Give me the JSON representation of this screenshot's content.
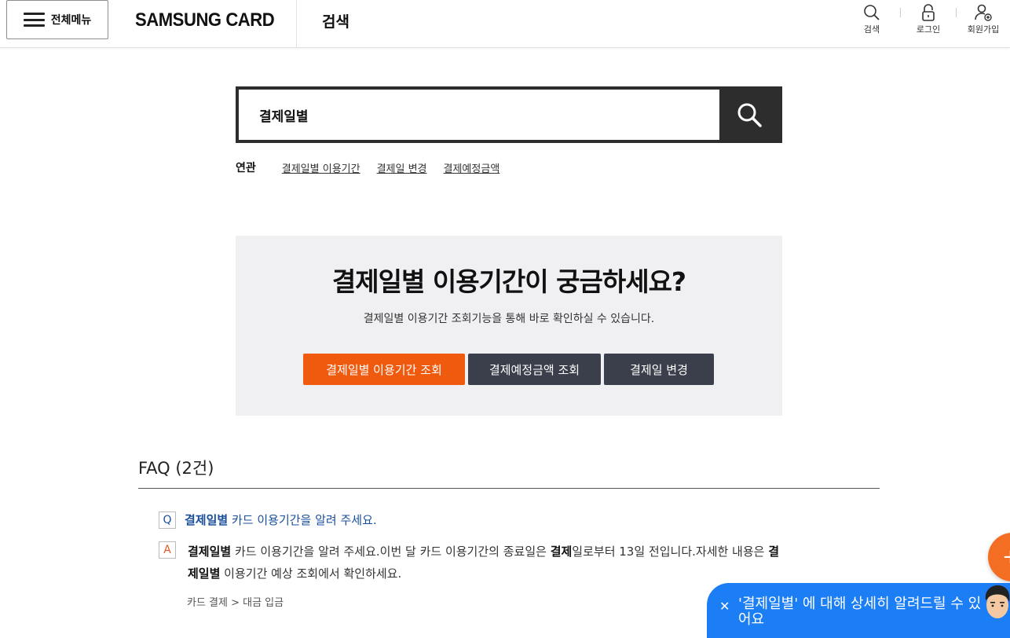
{
  "header": {
    "menu_label": "전체메뉴",
    "logo": "SAMSUNG CARD",
    "title": "검색",
    "utils": [
      {
        "icon": "search-icon",
        "label": "검색"
      },
      {
        "icon": "lock-icon",
        "label": "로그인"
      },
      {
        "icon": "user-add-icon",
        "label": "회원가입"
      }
    ]
  },
  "search": {
    "value": "결제일별",
    "related_label": "연관",
    "related": [
      "결제일별 이용기간",
      "결제일 변경",
      "결제예정금액"
    ]
  },
  "promo": {
    "title": "결제일별 이용기간이 궁금하세요?",
    "desc": "결제일별 이용기간 조회기능을 통해 바로 확인하실 수 있습니다.",
    "buttons": [
      "결제일별 이용기간 조회",
      "결제예정금액 조회",
      "결제일 변경"
    ]
  },
  "faq": {
    "title": "FAQ (2건)",
    "q_mark": "Q",
    "a_mark": "A",
    "question_keyword": "결제일별",
    "question_rest": " 카드 이용기간을 알려 주세요.",
    "answer": {
      "k1": "결제일별",
      "t1": " 카드 이용기간을 알려 주세요.이번 달 카드 이용기간의 종료일은 ",
      "k2": "결제",
      "t2": "일로부터 13일 전입니다.자세한 내용은 ",
      "k3": "결제일별",
      "t3": " 이용기간 예상 조회에서 확인하세요."
    },
    "category": "카드 결제 > 대금 입금"
  },
  "floating": {
    "fab_symbol": "+",
    "close_symbol": "✕",
    "chat_text": "'결제일별' 에 대해 상세히 알려드릴 수 있어요"
  },
  "colors": {
    "accent": "#f05a0e",
    "dark": "#2d2d2d",
    "button_dark": "#3a3f4b",
    "link_blue": "#1a4f9c",
    "chat_blue": "#1b7ef5"
  }
}
